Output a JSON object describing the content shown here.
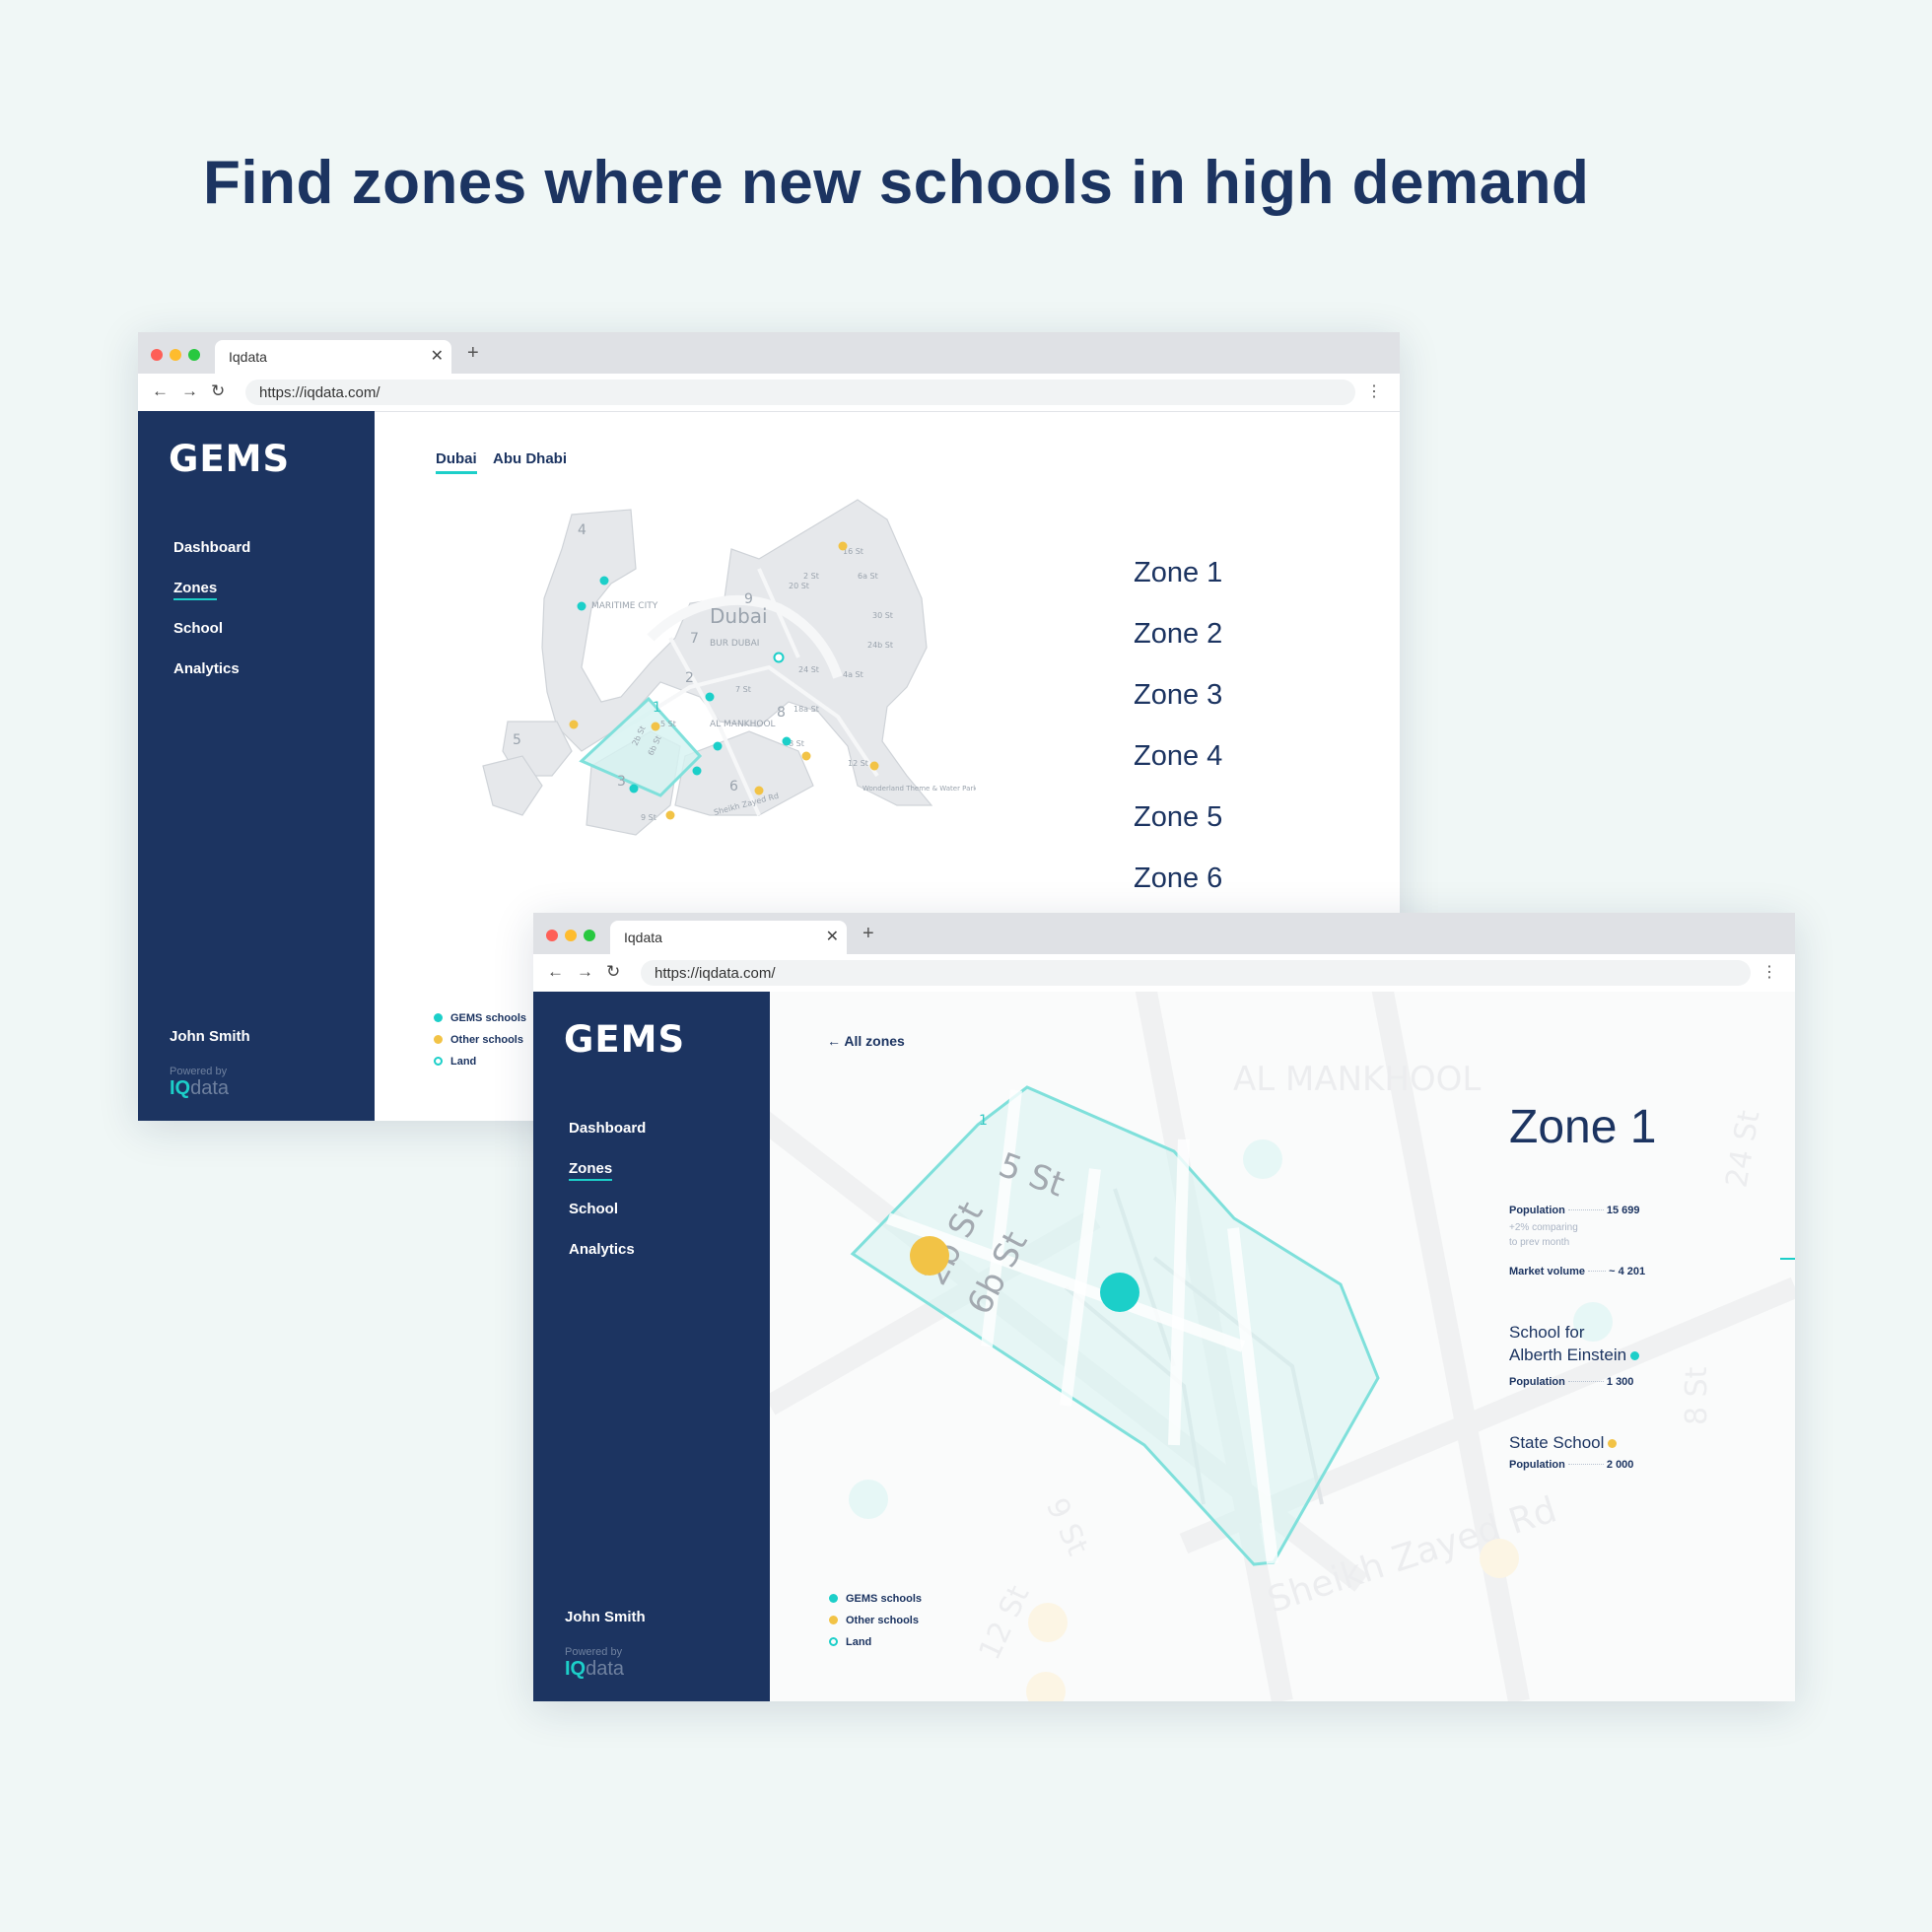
{
  "headline": "Find zones where new schools in high demand",
  "colors": {
    "navy": "#1c3461",
    "teal": "#1ccfc9",
    "yellow": "#f2c346",
    "background": "#f0f7f6",
    "map_land": "#e6e8eb"
  },
  "browser": {
    "tab_title": "Iqdata",
    "url": "https://iqdata.com/",
    "back_icon": "arrow-left",
    "forward_icon": "arrow-right",
    "reload_icon": "reload",
    "close_tab_icon": "close",
    "new_tab_icon": "plus",
    "menu_icon": "kebab"
  },
  "app": {
    "logo_text": "GEMS",
    "nav": [
      {
        "label": "Dashboard",
        "active": false
      },
      {
        "label": "Zones",
        "active": true
      },
      {
        "label": "School",
        "active": false
      },
      {
        "label": "Analytics",
        "active": false
      }
    ],
    "user_name": "John Smith",
    "powered_by": "Powered by",
    "brand_prefix": "IQ",
    "brand_suffix": "data"
  },
  "legend": [
    {
      "label": "GEMS schools",
      "kind": "filled",
      "color": "#1ccfc9"
    },
    {
      "label": "Other schools",
      "kind": "filled",
      "color": "#f2c346"
    },
    {
      "label": "Land",
      "kind": "ring",
      "color": "#1ccfc9"
    }
  ],
  "overview": {
    "cities": [
      {
        "label": "Dubai",
        "active": true
      },
      {
        "label": "Abu Dhabi",
        "active": false
      }
    ],
    "zones": [
      "Zone 1",
      "Zone 2",
      "Zone 3",
      "Zone 4",
      "Zone 5",
      "Zone 6"
    ],
    "map_labels": {
      "city": "Dubai",
      "district_maritime": "MARITIME CITY",
      "district_bur_dubai": "BUR DUBAI",
      "district_al_mankhool": "AL MANKHOOL",
      "zone_numbers": [
        "1",
        "2",
        "3",
        "4",
        "5",
        "6",
        "7",
        "8",
        "9"
      ],
      "streets": [
        "5 St",
        "2b St",
        "6b St",
        "7 St",
        "12 St",
        "16 St",
        "6a St",
        "30 St",
        "24b St",
        "4a St",
        "8 St",
        "20 St",
        "2 St",
        "9 St",
        "18a St",
        "24 St",
        "Sheikh Zayed Rd",
        "Wonderland Theme & Water Park"
      ]
    }
  },
  "detail": {
    "back_label": "All zones",
    "back_icon": "arrow-left",
    "zone_title": "Zone 1",
    "zone_marker": "1",
    "population_label": "Population",
    "population_value": "15 699",
    "population_note_line1": "+2% comparing",
    "population_note_line2": "to prev month",
    "market_label": "Market volume",
    "market_value": "~ 4 201",
    "schools": [
      {
        "name_line1": "School for",
        "name_line2": "Alberth Einstein",
        "type": "gems",
        "population_label": "Population",
        "population": "1 300"
      },
      {
        "name_line1": "State School",
        "name_line2": "",
        "type": "other",
        "population_label": "Population",
        "population": "2 000"
      }
    ],
    "map_labels": {
      "streets": [
        "5 St",
        "2b St",
        "6b St",
        "9 St",
        "12 St",
        "24 St",
        "8 St",
        "Sheikh Zayed Rd"
      ],
      "district": "AL MANKHOOL"
    }
  }
}
